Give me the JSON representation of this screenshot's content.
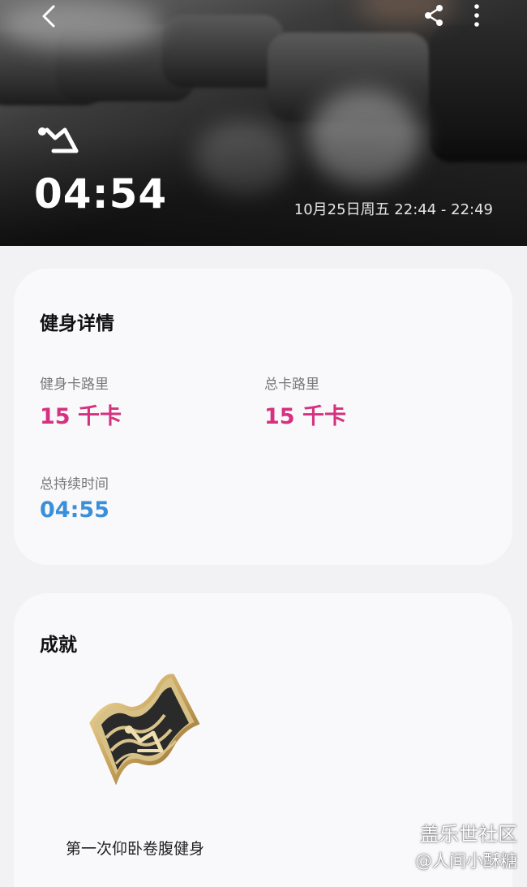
{
  "hero": {
    "duration": "04:54",
    "date_range": "10月25日周五 22:44 - 22:49",
    "back_icon": "chevron-left-icon",
    "share_icon": "share-icon",
    "more_icon": "more-vertical-icon",
    "workout_icon": "sit-up-icon"
  },
  "details": {
    "title": "健身详情",
    "workout_calories_label": "健身卡路里",
    "workout_calories_value": "15 千卡",
    "total_calories_label": "总卡路里",
    "total_calories_value": "15 千卡",
    "total_duration_label": "总持续时间",
    "total_duration_value": "04:55"
  },
  "achievements": {
    "title": "成就",
    "badge_name": "第一次仰卧卷腹健身"
  },
  "watermark": {
    "line1": "盖乐世社区",
    "line2": "@人间小酥糖"
  },
  "colors": {
    "calories": "#d6317e",
    "duration": "#3b8fd9",
    "card_bg": "#f9f9fb",
    "page_bg": "#f2f2f5"
  }
}
